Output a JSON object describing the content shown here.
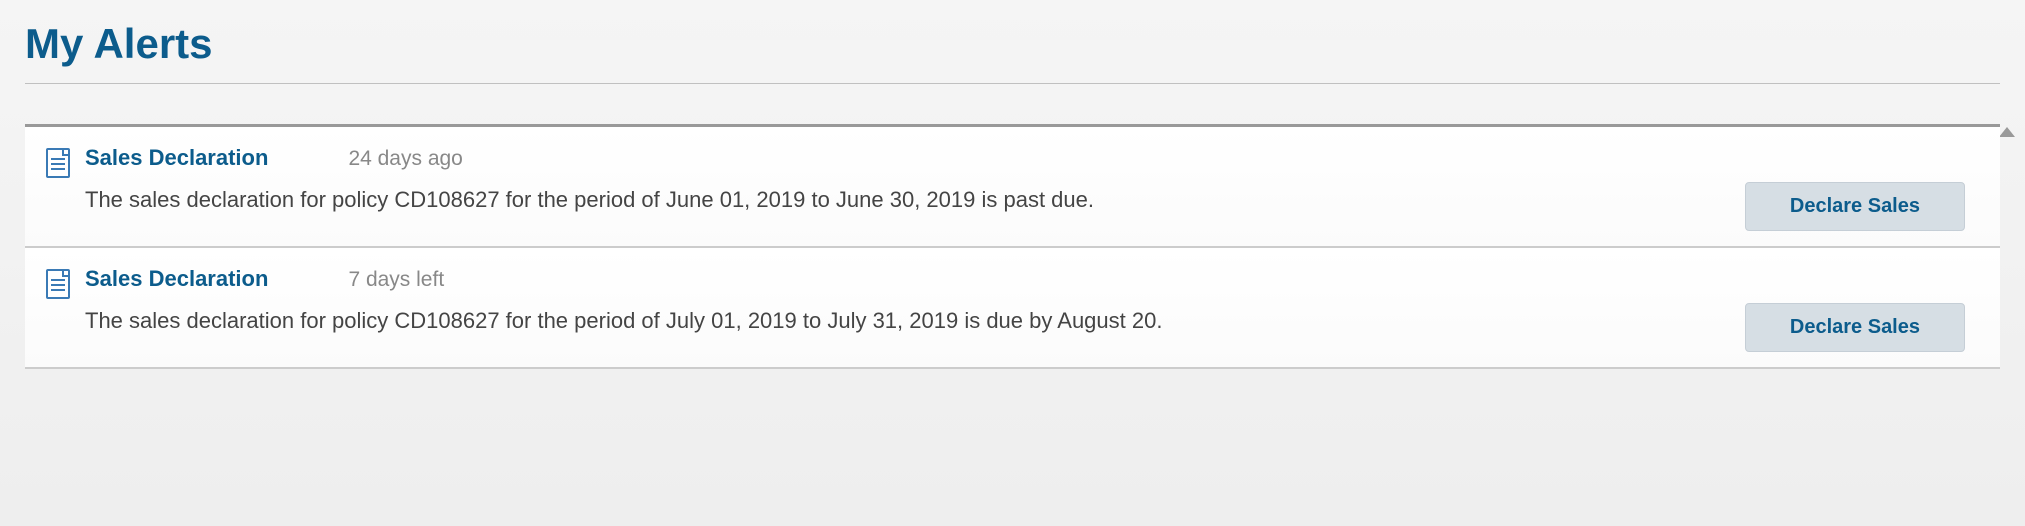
{
  "header": {
    "title": "My Alerts"
  },
  "alerts": [
    {
      "title": "Sales Declaration",
      "time": "24 days ago",
      "description": "The sales declaration for policy CD108627 for the period of June 01, 2019 to June 30, 2019 is past due.",
      "action_label": "Declare Sales"
    },
    {
      "title": "Sales Declaration",
      "time": "7 days left",
      "description": "The sales declaration for policy CD108627 for the period of July 01, 2019 to July 31, 2019 is due by August 20.",
      "action_label": "Declare Sales"
    }
  ]
}
